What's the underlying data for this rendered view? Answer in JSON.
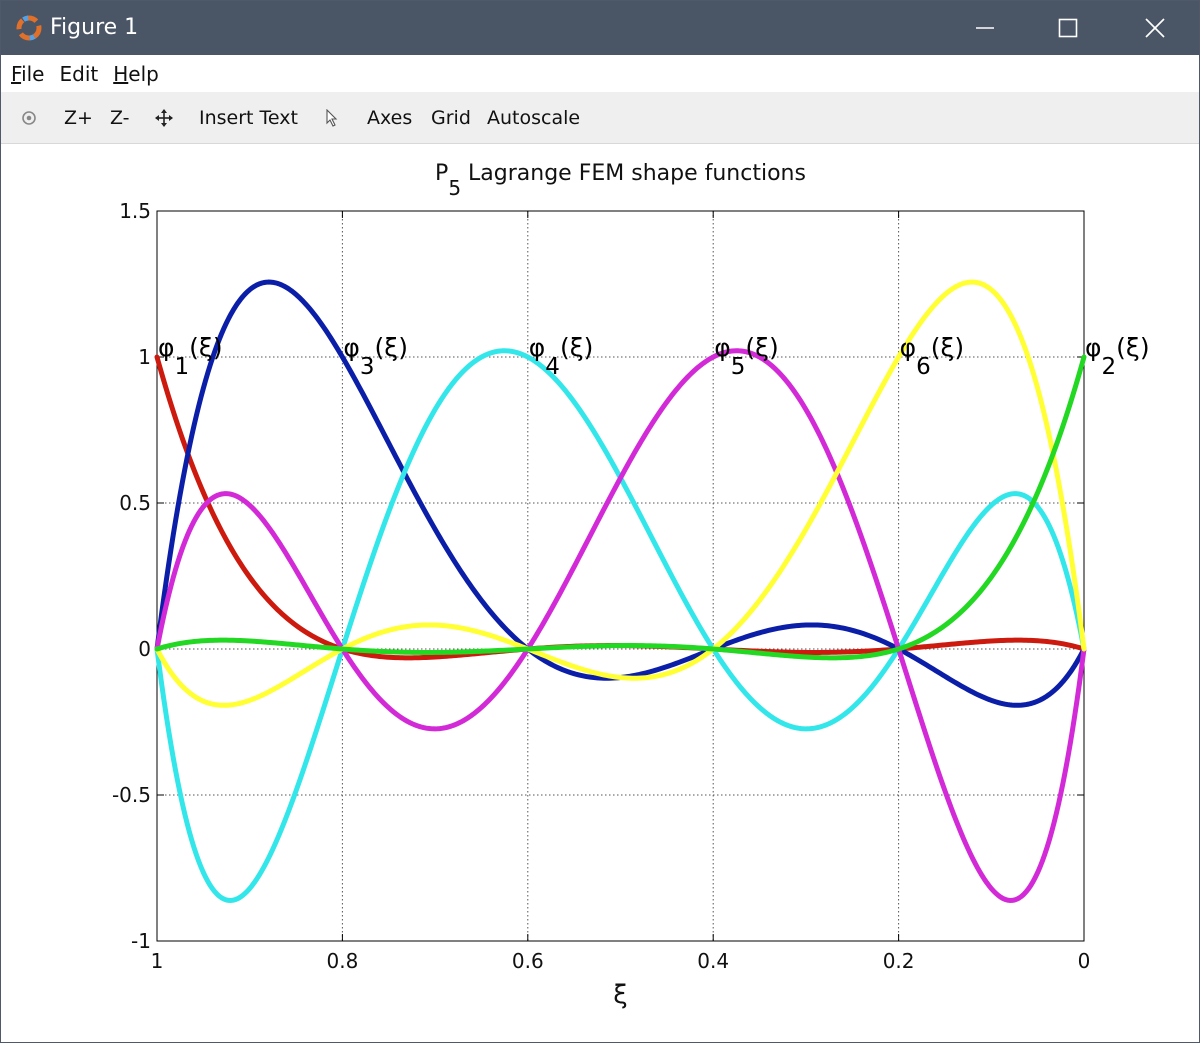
{
  "window": {
    "title": "Figure 1",
    "controls": {
      "minimize": "minimize",
      "maximize": "maximize",
      "close": "close"
    }
  },
  "menu": {
    "file": {
      "accel": "F",
      "rest": "ile"
    },
    "edit": {
      "label": "Edit"
    },
    "help": {
      "accel": "H",
      "rest": "elp"
    }
  },
  "toolbar": {
    "zoom_in": "Z+",
    "zoom_out": "Z-",
    "insert_text": "Insert Text",
    "axes": "Axes",
    "grid": "Grid",
    "autoscale": "Autoscale"
  },
  "colors": {
    "titlebar": "#4a5566",
    "phi1": "#cc1a0e",
    "phi2": "#22d822",
    "phi3": "#0b1ea8",
    "phi4": "#33e6ea",
    "phi5": "#d22ad6",
    "phi6": "#ffff33"
  },
  "chart_data": {
    "type": "line",
    "title_main": "P",
    "title_sub": "5",
    "title_rest": " Lagrange FEM shape functions",
    "xlabel": "ξ",
    "ylabel": "",
    "xlim": [
      1,
      0
    ],
    "ylim": [
      -1,
      1.5
    ],
    "x_reversed": true,
    "grid": true,
    "x_ticks": [
      1,
      0.8,
      0.6,
      0.4,
      0.2,
      0
    ],
    "x_tick_labels": [
      "1",
      "0.8",
      "0.6",
      "0.4",
      "0.2",
      "0"
    ],
    "y_ticks": [
      -1,
      -0.5,
      0,
      0.5,
      1,
      1.5
    ],
    "y_tick_labels": [
      "-1",
      "-0.5",
      "0",
      "0.5",
      "1",
      "1.5"
    ],
    "nodes": [
      1,
      0.8,
      0.6,
      0.4,
      0.2,
      0
    ],
    "series": [
      {
        "id": "phi1",
        "node_index": 0,
        "color": "#cc1a0e"
      },
      {
        "id": "phi3",
        "node_index": 1,
        "color": "#0b1ea8"
      },
      {
        "id": "phi4",
        "node_index": 2,
        "color": "#33e6ea"
      },
      {
        "id": "phi5",
        "node_index": 3,
        "color": "#d22ad6"
      },
      {
        "id": "phi6",
        "node_index": 4,
        "color": "#ffff33"
      },
      {
        "id": "phi2",
        "node_index": 5,
        "color": "#22d822"
      }
    ],
    "annotations": [
      {
        "id": "phi1",
        "x": 1,
        "y": 1,
        "base": "φ",
        "sub": "1",
        "suffix": "(ξ)"
      },
      {
        "id": "phi3",
        "x": 0.8,
        "y": 1,
        "base": "φ",
        "sub": "3",
        "suffix": "(ξ)"
      },
      {
        "id": "phi4",
        "x": 0.6,
        "y": 1,
        "base": "φ",
        "sub": "4",
        "suffix": "(ξ)"
      },
      {
        "id": "phi5",
        "x": 0.4,
        "y": 1,
        "base": "φ",
        "sub": "5",
        "suffix": "(ξ)"
      },
      {
        "id": "phi6",
        "x": 0.2,
        "y": 1,
        "base": "φ",
        "sub": "6",
        "suffix": "(ξ)"
      },
      {
        "id": "phi2",
        "x": 0,
        "y": 1,
        "base": "φ",
        "sub": "2",
        "suffix": "(ξ)"
      }
    ]
  }
}
